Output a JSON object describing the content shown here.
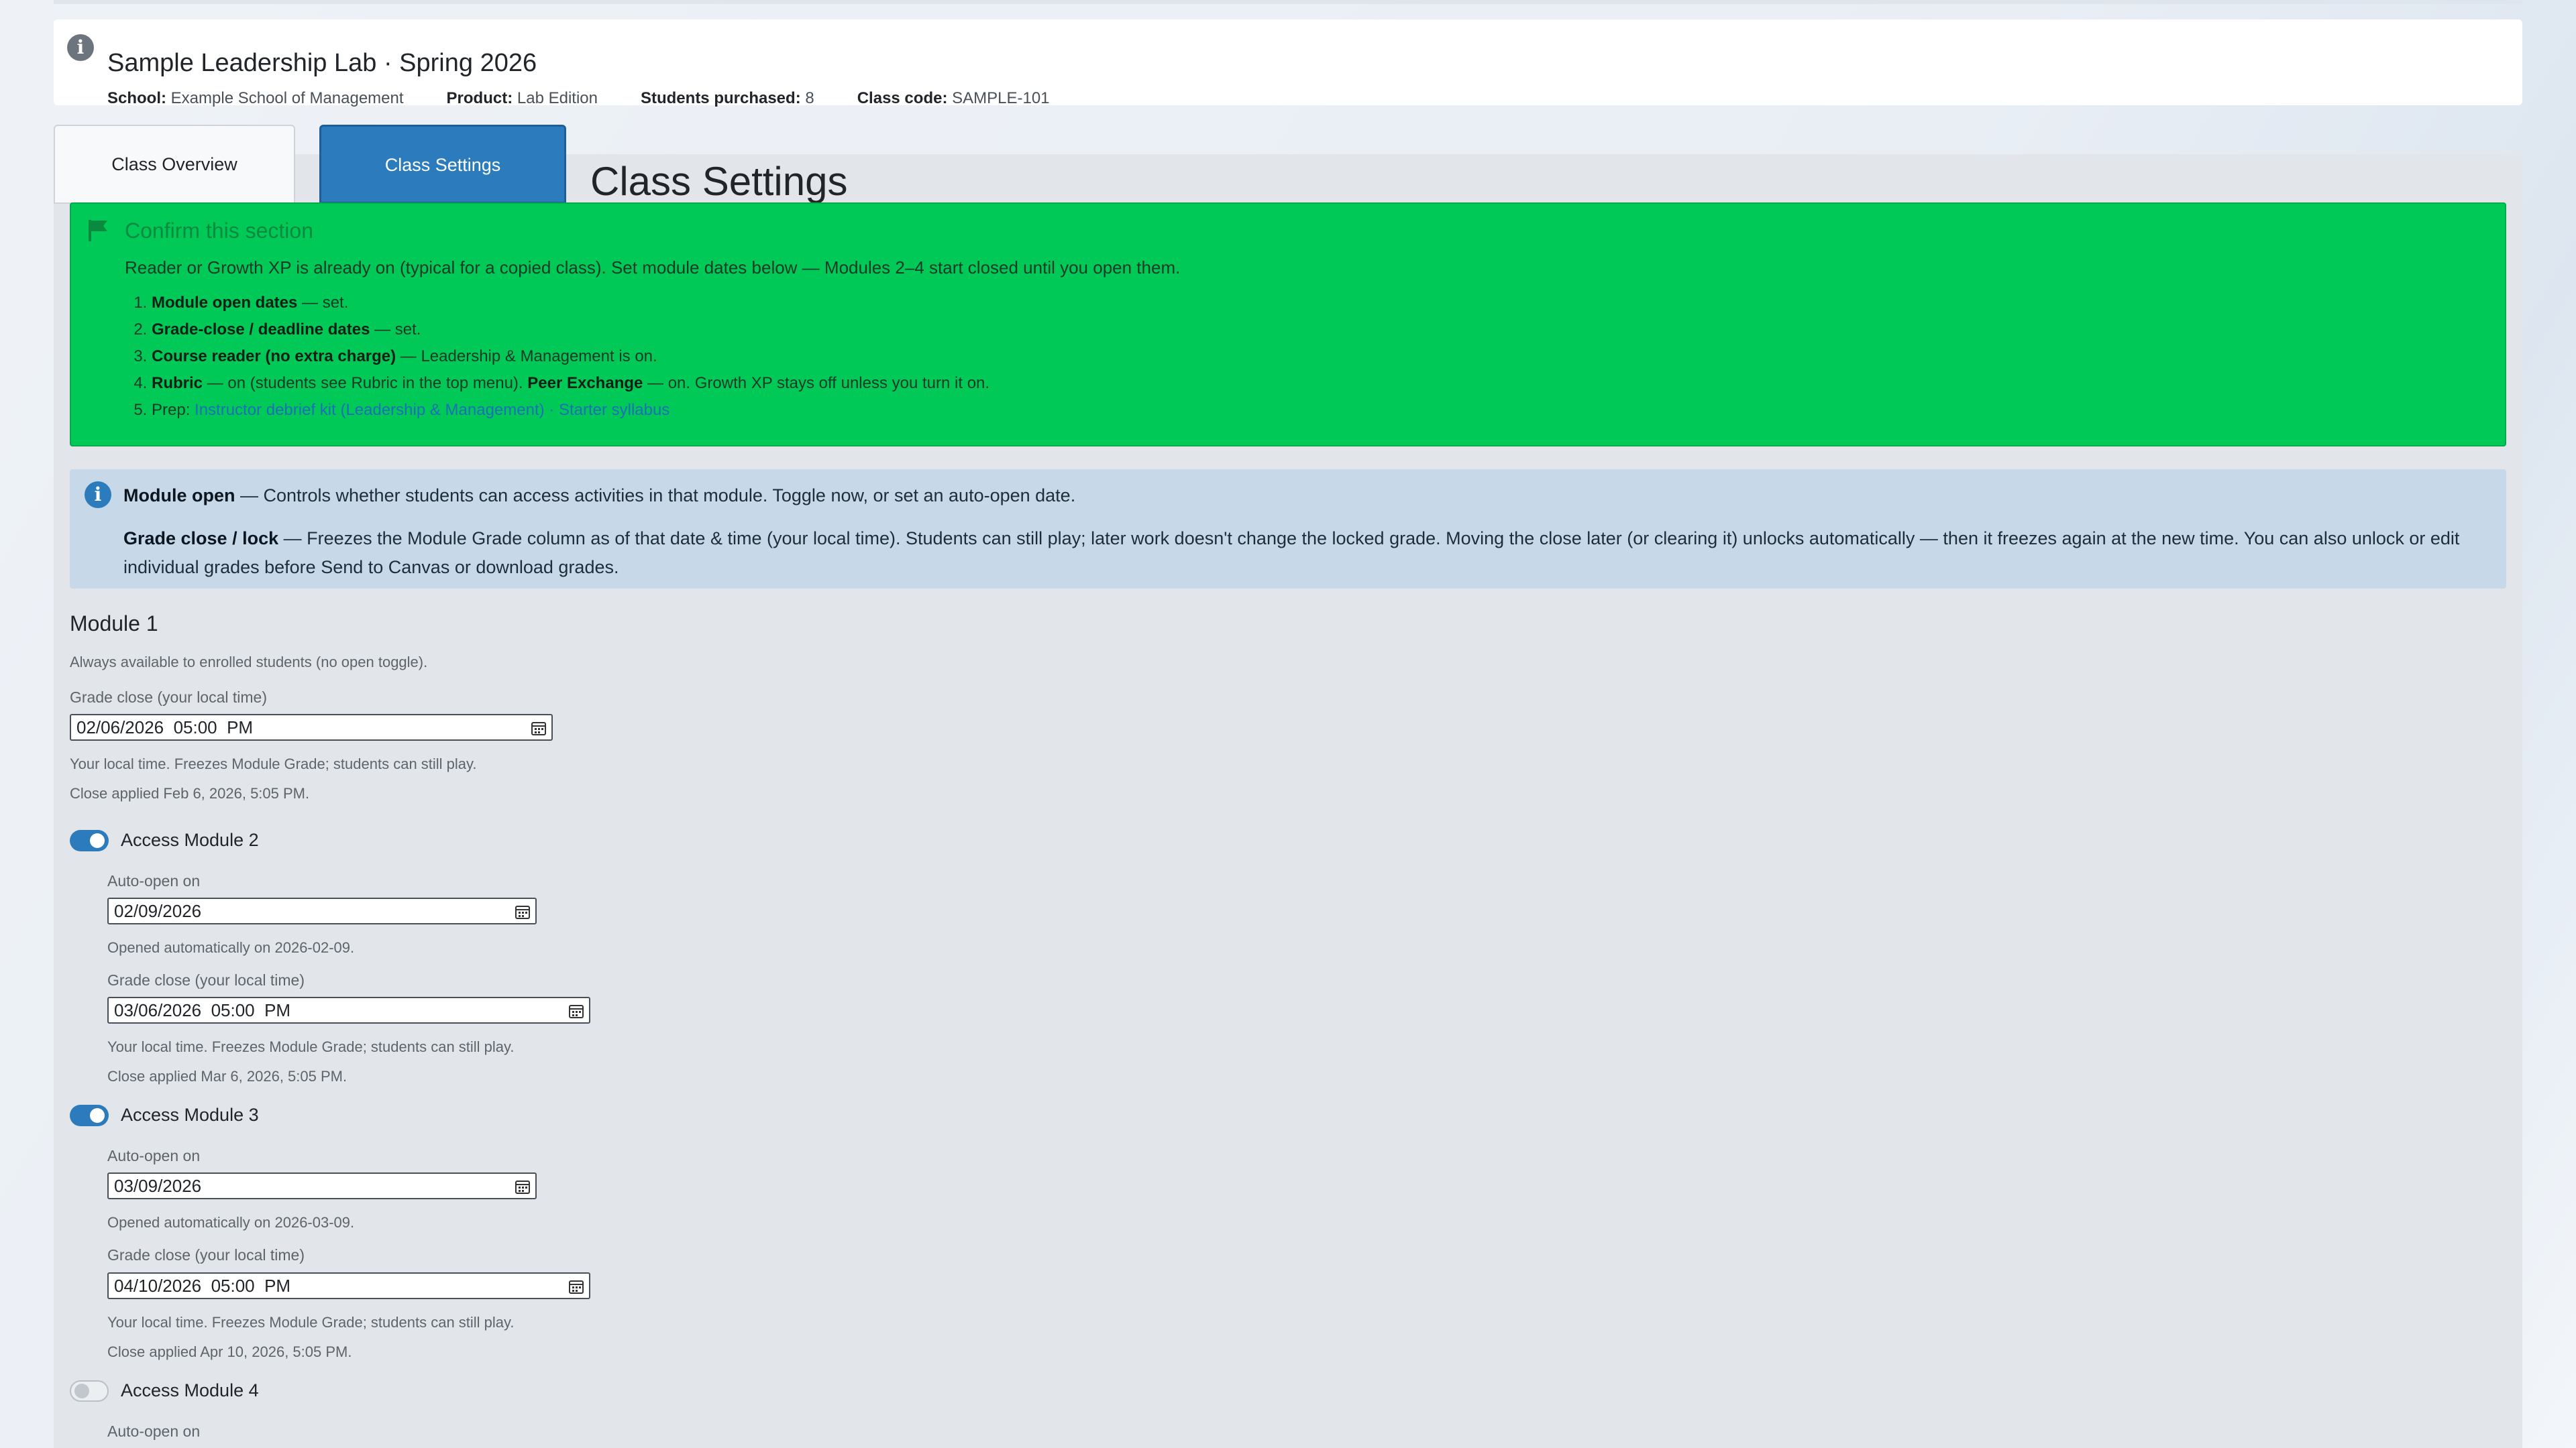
{
  "header": {
    "title": "Sample Leadership Lab · Spring 2026",
    "school_label": "School:",
    "school": "Example School of Management",
    "product_label": "Product:",
    "product": "Lab Edition",
    "students_label": "Students purchased:",
    "students": "8",
    "code_label": "Class code:",
    "code": "SAMPLE-101"
  },
  "tabs": {
    "overview": "Class Overview",
    "settings": "Class Settings",
    "active": "settings"
  },
  "section_heading": "Class Settings",
  "confirm": {
    "title": "Confirm this section",
    "lead": "Reader or Growth XP is already on (typical for a copied class). Set module dates below — Modules 2–4 start closed until you open them.",
    "items": [
      {
        "b": "Module open dates",
        "t": " — set."
      },
      {
        "b": "Grade-close / deadline dates",
        "t": " — set."
      },
      {
        "b": "Course reader (no extra charge)",
        "t": " — Leadership & Management is on."
      },
      {
        "b": "Rubric",
        "t": " — on (students see Rubric in the top menu). ",
        "b2": "Peer Exchange",
        "t2": " — on. Growth XP stays off unless you turn it on."
      }
    ],
    "prep_label": "Prep: ",
    "prep_link1": "Instructor debrief kit (Leadership & Management)",
    "prep_sep": " · ",
    "prep_link2": "Starter syllabus"
  },
  "info": {
    "open_b": "Module open",
    "open_t": " — Controls whether students can access activities in that module. Toggle now, or set an auto-open date.",
    "close_b": "Grade close / lock",
    "close_t": " — Freezes the Module Grade column as of that date & time (your local time). Students can still play; later work doesn't change the locked grade. Moving the close later (or clearing it) unlocks automatically — then it freezes again at the new time. You can also unlock or edit individual grades before Send to Canvas or download grades."
  },
  "module1": {
    "title": "Module 1",
    "note": "Always available to enrolled students (no open toggle).",
    "close_label": "Grade close (your local time)",
    "close_value": "02/06/2026  05:00  PM",
    "help": "Your local time. Freezes Module Grade; students can still play.",
    "applied": "Close applied Feb 6, 2026, 5:05 PM."
  },
  "module2": {
    "toggle_label": "Access Module 2",
    "on": true,
    "auto_label": "Auto-open on",
    "auto_value": "02/09/2026",
    "opened": "Opened automatically on 2026-02-09.",
    "close_label": "Grade close (your local time)",
    "close_value": "03/06/2026  05:00  PM",
    "help": "Your local time. Freezes Module Grade; students can still play.",
    "applied": "Close applied Mar 6, 2026, 5:05 PM."
  },
  "module3": {
    "toggle_label": "Access Module 3",
    "on": true,
    "auto_label": "Auto-open on",
    "auto_value": "03/09/2026",
    "opened": "Opened automatically on 2026-03-09.",
    "close_label": "Grade close (your local time)",
    "close_value": "04/10/2026  05:00  PM",
    "help": "Your local time. Freezes Module Grade; students can still play.",
    "applied": "Close applied Apr 10, 2026, 5:05 PM."
  },
  "module4": {
    "toggle_label": "Access Module 4",
    "on": false,
    "auto_label": "Auto-open on"
  },
  "colors": {
    "primary": "#2b7bbd",
    "confirm_green": "#00c957",
    "info_blue": "#c7d8e8"
  }
}
